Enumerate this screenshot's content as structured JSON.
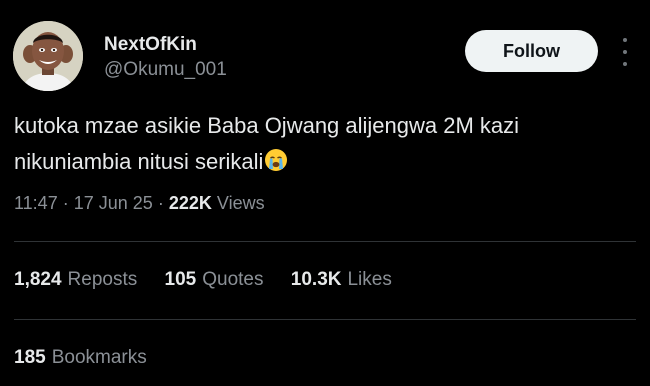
{
  "user": {
    "display_name": "NextOfKin",
    "handle": "@Okumu_001",
    "avatar_icon": "user-avatar"
  },
  "follow_button": {
    "label": "Follow"
  },
  "more_menu": {
    "icon": "more-vertical-icon"
  },
  "tweet": {
    "text_lines": [
      "kutoka mzae asikie Baba Ojwang alijengwa 2M kazi",
      "nikuniambia nitusi serikali"
    ],
    "emoji": "loudly-crying-face-emoji"
  },
  "meta": {
    "time": "11:47",
    "separator": "·",
    "date": "17 Jun 25",
    "views_count": "222K",
    "views_label": "Views"
  },
  "stats": {
    "reposts": {
      "count": "1,824",
      "label": "Reposts"
    },
    "quotes": {
      "count": "105",
      "label": "Quotes"
    },
    "likes": {
      "count": "10.3K",
      "label": "Likes"
    },
    "bookmarks": {
      "count": "185",
      "label": "Bookmarks"
    }
  },
  "colors": {
    "background": "#000000",
    "primary_text": "#e7e9ea",
    "secondary_text": "#8b9096",
    "divider": "#2f3336",
    "button_bg": "#eff3f4",
    "button_text": "#0f1419"
  }
}
